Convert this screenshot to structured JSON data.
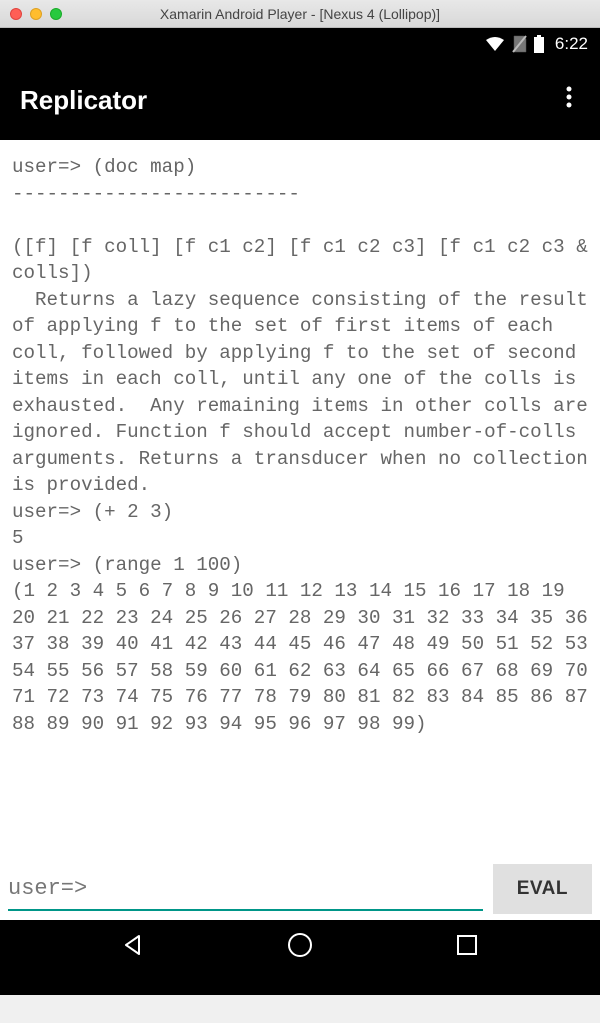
{
  "window": {
    "title": "Xamarin Android Player - [Nexus 4 (Lollipop)]"
  },
  "statusBar": {
    "time": "6:22"
  },
  "appBar": {
    "title": "Replicator"
  },
  "repl": {
    "output": "user=> (doc map)\n-------------------------\n\n([f] [f coll] [f c1 c2] [f c1 c2 c3] [f c1 c2 c3 & colls])\n  Returns a lazy sequence consisting of the result of applying f to the set of first items of each coll, followed by applying f to the set of second items in each coll, until any one of the colls is exhausted.  Any remaining items in other colls are ignored. Function f should accept number-of-colls arguments. Returns a transducer when no collection is provided.\nuser=> (+ 2 3)\n5\nuser=> (range 1 100)\n(1 2 3 4 5 6 7 8 9 10 11 12 13 14 15 16 17 18 19 20 21 22 23 24 25 26 27 28 29 30 31 32 33 34 35 36 37 38 39 40 41 42 43 44 45 46 47 48 49 50 51 52 53 54 55 56 57 58 59 60 61 62 63 64 65 66 67 68 69 70 71 72 73 74 75 76 77 78 79 80 81 82 83 84 85 86 87 88 89 90 91 92 93 94 95 96 97 98 99)",
    "promptLabel": "user=>",
    "inputPlaceholder": "",
    "evalLabel": "EVAL"
  },
  "icons": {
    "wifi": "wifi-icon",
    "noSim": "no-sim-icon",
    "battery": "battery-icon",
    "overflow": "overflow-menu-icon",
    "back": "back-icon",
    "home": "home-icon",
    "recent": "recent-icon"
  }
}
